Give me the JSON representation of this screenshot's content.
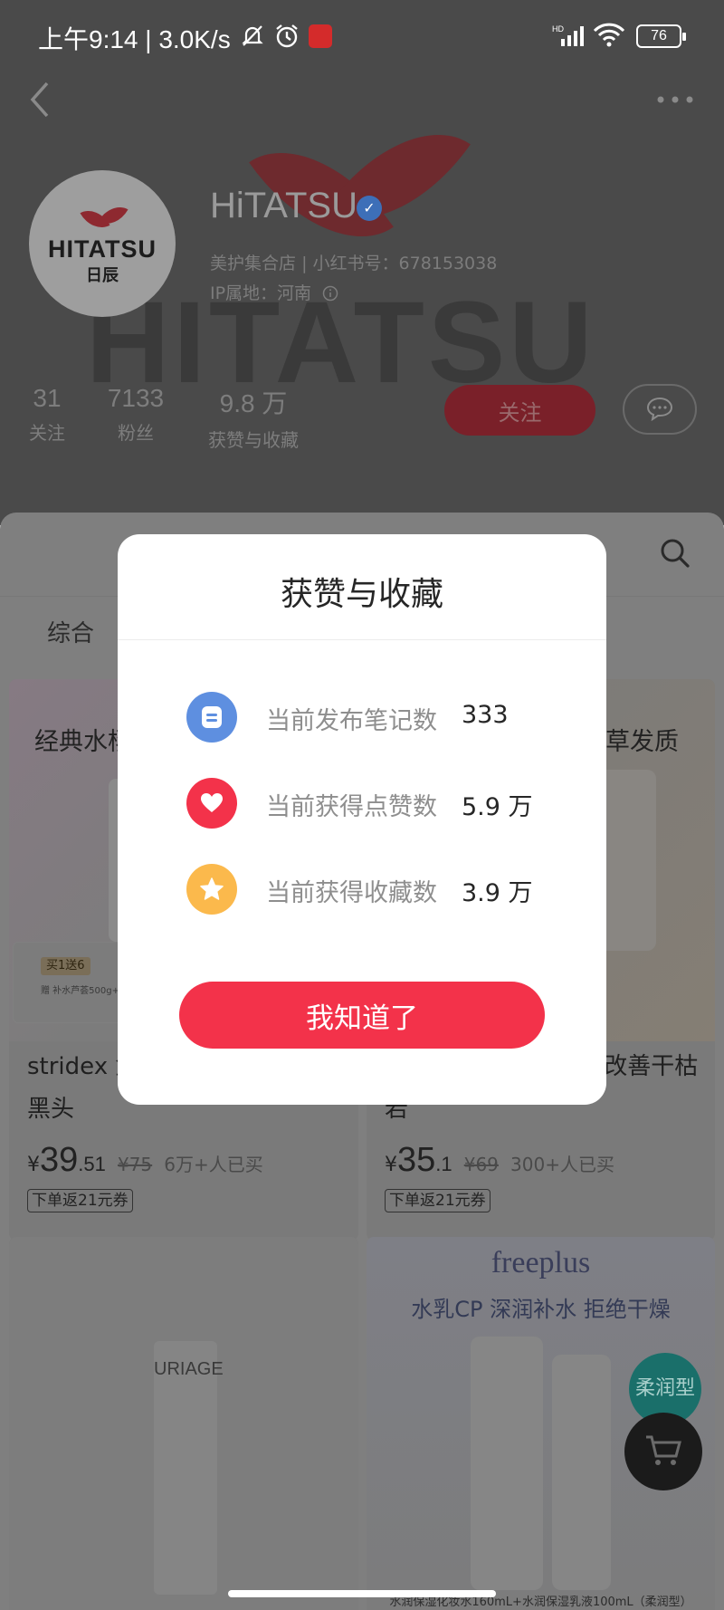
{
  "status_bar": {
    "time": "上午9:14 | 3.0K/s",
    "battery": "76"
  },
  "profile": {
    "logo_text": "HITATSU",
    "logo_sub": "日辰",
    "bg_brand": "HITATSU",
    "name": "HiTATSU",
    "category": "美护集合店",
    "id_label": "小红书号：678153038",
    "ip_location": "IP属地：河南",
    "stats": [
      {
        "value": "31",
        "label": "关注"
      },
      {
        "value": "7133",
        "label": "粉丝"
      },
      {
        "value": "9.8 万",
        "label": "获赞与收藏"
      }
    ],
    "follow_label": "关注"
  },
  "tabs": {
    "combined": "综合"
  },
  "products": [
    {
      "headline": "经典水杨",
      "promo_tag": "买1送6",
      "promo_desc": "赠 补水芦荟500g+压模",
      "title": "stridex 盒祛痘痘去闭口粉刺黑头",
      "price_currency": "¥",
      "price_int": "39",
      "price_dec": ".51",
      "orig_price": "¥75",
      "sold": "6万+人已买",
      "coupon": "下单返21元券"
    },
    {
      "headline": "草发质",
      "title": "护发精 油防毛躁柔顺改善干枯若",
      "price_currency": "¥",
      "price_int": "35",
      "price_dec": ".1",
      "orig_price": "¥69",
      "sold": "300+人已买",
      "coupon": "下单返21元券"
    },
    {
      "brand": "URIAGE"
    },
    {
      "brand": "freeplus",
      "headline": "水乳CP  深润补水 拒绝干燥",
      "badge": "柔润型",
      "caption": "水润保湿化妆水160mL+水润保湿乳液100mL（柔润型）"
    }
  ],
  "dialog": {
    "title": "获赞与收藏",
    "rows": [
      {
        "label": "当前发布笔记数",
        "value": "333",
        "icon": "note-icon"
      },
      {
        "label": "当前获得点赞数",
        "value": "5.9 万",
        "icon": "heart-icon"
      },
      {
        "label": "当前获得收藏数",
        "value": "3.9 万",
        "icon": "star-icon"
      }
    ],
    "confirm_label": "我知道了"
  },
  "colors": {
    "accent": "#f3324a",
    "note_blue": "#5e8fe0",
    "star_yellow": "#fbb94c",
    "overlay": "#4a4a4a"
  }
}
